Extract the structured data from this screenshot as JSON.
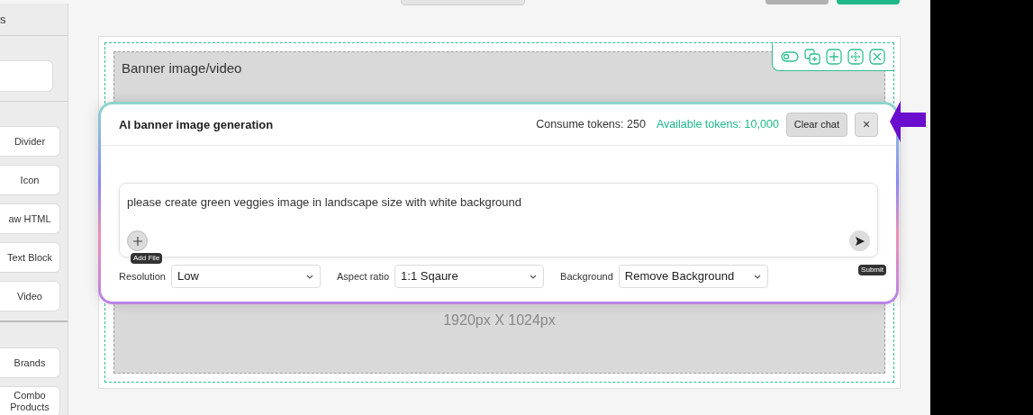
{
  "sidebar": {
    "header": "s",
    "blocks_a": [
      {
        "label": "Divider"
      },
      {
        "label": "Icon"
      },
      {
        "label": "aw HTML"
      },
      {
        "label": "Text Block"
      },
      {
        "label": "Video"
      }
    ],
    "blocks_b": [
      {
        "label": "Brands"
      },
      {
        "label": "Combo Products"
      }
    ]
  },
  "canvas": {
    "banner_title": "Banner image/video",
    "banner_size": "1920px X 1024px"
  },
  "modal": {
    "title": "AI banner image generation",
    "consume_tokens": "Consume tokens: 250",
    "available_tokens": "Available tokens: 10,000",
    "clear_button": "Clear chat",
    "close_button": "×",
    "prompt": "please create green veggies image in landscape size with white background",
    "add_file_tooltip": "Add File",
    "submit_tooltip": "Submit",
    "options": [
      {
        "label": "Resolution",
        "value": "Low"
      },
      {
        "label": "Aspect ratio",
        "value": "1:1 Sqaure"
      },
      {
        "label": "Background",
        "value": "Remove Background"
      }
    ]
  }
}
